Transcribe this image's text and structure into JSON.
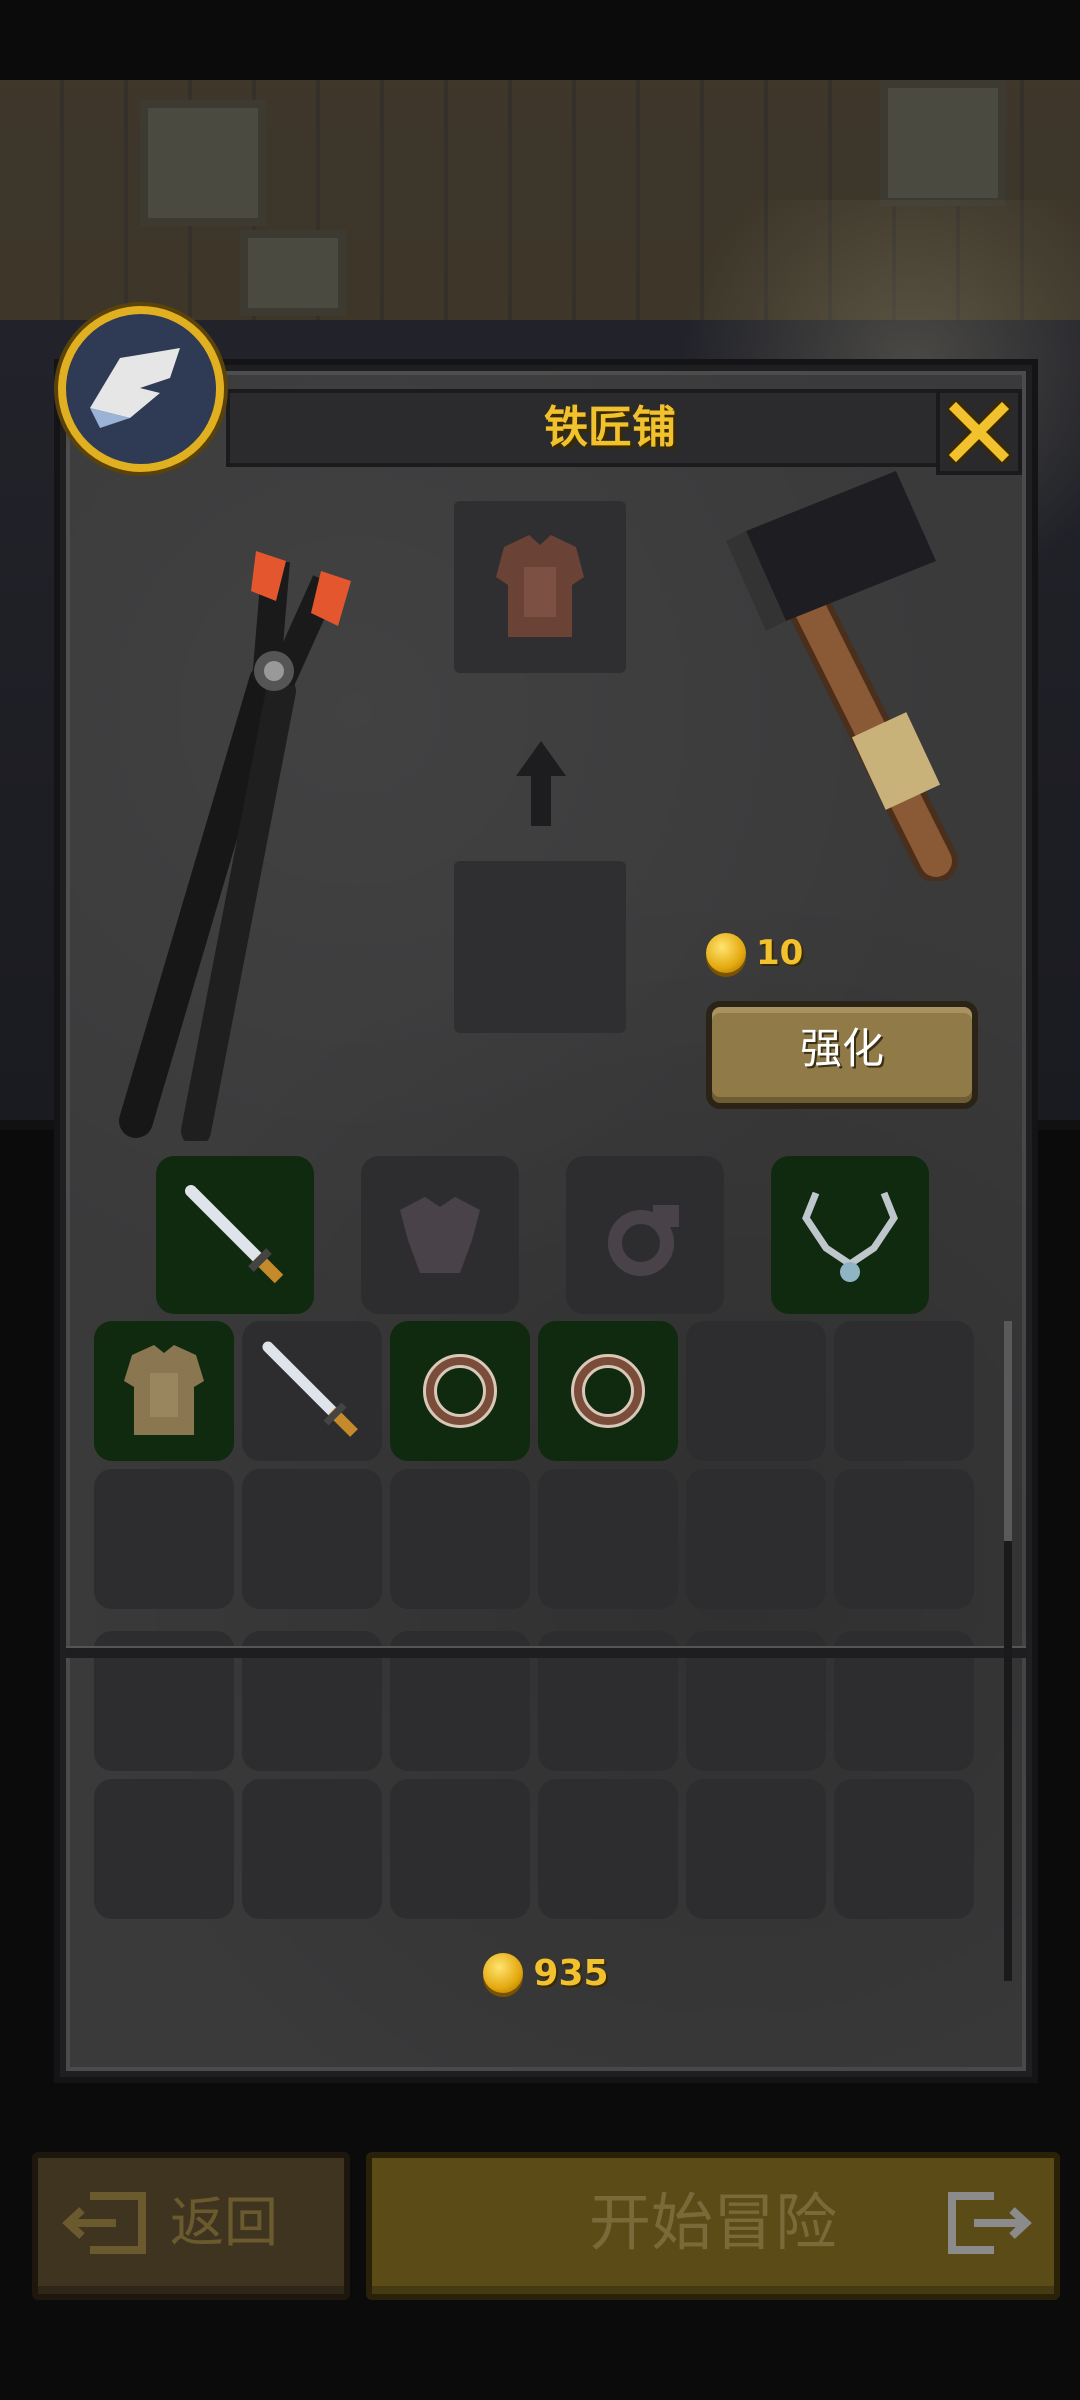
{
  "header": {
    "title": "铁匠铺"
  },
  "enhance": {
    "cost": "10",
    "button_label": "强化"
  },
  "equipment_slots": [
    {
      "name": "weapon",
      "state": "filled",
      "icon": "dagger-icon"
    },
    {
      "name": "armor",
      "state": "empty",
      "icon": "armor-silhouette-icon"
    },
    {
      "name": "ring",
      "state": "empty",
      "icon": "ring-silhouette-icon"
    },
    {
      "name": "amulet",
      "state": "filled",
      "icon": "necklace-icon"
    }
  ],
  "inventory": {
    "row1": [
      {
        "icon": "leather-armor-icon",
        "highlight": true
      },
      {
        "icon": "dagger-icon",
        "highlight": false
      },
      {
        "icon": "ring-icon",
        "highlight": true
      },
      {
        "icon": "ring-icon",
        "highlight": true
      },
      {
        "icon": "",
        "highlight": false
      },
      {
        "icon": "",
        "highlight": false
      }
    ]
  },
  "footer": {
    "gold": "935",
    "back_label": "返回",
    "start_label": "开始冒险"
  },
  "colors": {
    "title": "#f2c12e",
    "slot_highlight": "#0f2a0f",
    "button": "#8f7a48"
  }
}
